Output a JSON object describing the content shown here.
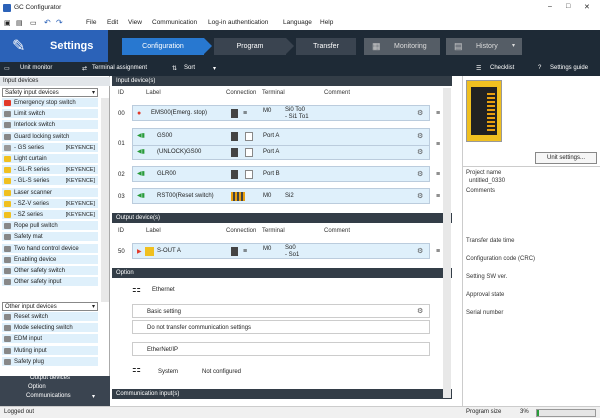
{
  "window": {
    "title": "GC Configurator",
    "min": "–",
    "max": "□",
    "close": "✕"
  },
  "menu": [
    "File",
    "Edit",
    "View",
    "Communication",
    "Log-in authentication",
    "Language",
    "Help"
  ],
  "header": {
    "section": "Settings",
    "steps": [
      "Configuration",
      "Program",
      "Transfer"
    ],
    "monitor": "Monitoring",
    "history": "History"
  },
  "toolbar": {
    "unit_monitor": "Unit monitor",
    "terminal_assignment": "Terminal assignment",
    "sort": "Sort",
    "checklist": "Checklist",
    "settings_guide": "Settings guide"
  },
  "left": {
    "header": "Input devices",
    "category": "Safety input devices",
    "items": [
      {
        "label": "Emergency stop switch",
        "key": "",
        "color": "#e23a2a"
      },
      {
        "label": "Limit switch",
        "key": "",
        "color": "#888"
      },
      {
        "label": "Interlock switch",
        "key": "",
        "color": "#888"
      },
      {
        "label": "Guard locking switch",
        "key": "",
        "color": "#888"
      },
      {
        "label": "- GS series",
        "key": "[KEYENCE]",
        "color": "#999"
      },
      {
        "label": "Light curtain",
        "key": "",
        "color": "#f0c020"
      },
      {
        "label": "- GL-R series",
        "key": "[KEYENCE]",
        "color": "#f0c020"
      },
      {
        "label": "- GL-S series",
        "key": "[KEYENCE]",
        "color": "#f0c020"
      },
      {
        "label": "Laser scanner",
        "key": "",
        "color": "#f0c020"
      },
      {
        "label": "- SZ-V series",
        "key": "[KEYENCE]",
        "color": "#f0c020"
      },
      {
        "label": "- SZ series",
        "key": "[KEYENCE]",
        "color": "#f0c020"
      },
      {
        "label": "Rope pull switch",
        "key": "",
        "color": "#888"
      },
      {
        "label": "Safety mat",
        "key": "",
        "color": "#888"
      },
      {
        "label": "Two hand control device",
        "key": "",
        "color": "#888"
      },
      {
        "label": "Enabling device",
        "key": "",
        "color": "#888"
      },
      {
        "label": "Other safety switch",
        "key": "",
        "color": "#888"
      },
      {
        "label": "Other safety input",
        "key": "",
        "color": "#888"
      }
    ],
    "category2": "Other input devices",
    "items2": [
      "Reset switch",
      "Mode selecting switch",
      "EDM input",
      "Muting input",
      "Safety plug"
    ],
    "footer": [
      "Output devices",
      "Option",
      "Communications"
    ]
  },
  "main": {
    "input_header": "Input device(s)",
    "cols": {
      "id": "ID",
      "label": "Label",
      "connection": "Connection",
      "terminal": "Terminal",
      "comment": "Comment"
    },
    "inputs": [
      {
        "id": "00",
        "label": "EMS00(Emerg. stop)",
        "t1": "M0",
        "t2": "Si0 To0",
        "t3": "- Si1 To1"
      },
      {
        "id": "01",
        "label": "GS00",
        "t1": "",
        "t2": "Port A",
        "t3": ""
      },
      {
        "id": "",
        "label": "(UNLOCK)GS00",
        "t1": "",
        "t2": "Port A",
        "t3": ""
      },
      {
        "id": "02",
        "label": "GLR00",
        "t1": "",
        "t2": "Port B",
        "t3": ""
      },
      {
        "id": "03",
        "label": "RST00(Reset switch)",
        "t1": "M0",
        "t2": "Si2",
        "t3": ""
      }
    ],
    "output_header": "Output device(s)",
    "outputs": [
      {
        "id": "50",
        "label": "S-OUT A",
        "t1": "M0",
        "t2": "So0",
        "t3": "- So1"
      }
    ],
    "option_header": "Option",
    "ethernet": "Ethernet",
    "basic_setting": "Basic setting",
    "no_transfer": "Do not transfer communication settings",
    "ethernetip": "EtherNet/IP",
    "system": "System",
    "not_configured": "Not configured",
    "comm_header": "Communication input(s)"
  },
  "right": {
    "unit_settings": "Unit settings...",
    "project_name_lbl": "Project name",
    "project_name": "untitled_0330",
    "comments": "Comments",
    "transfer_date": "Transfer date time",
    "config_code": "Configuration code (CRC)",
    "setting_sw": "Setting SW ver.",
    "approval": "Approval state",
    "serial": "Serial number"
  },
  "status": {
    "logged": "Logged out",
    "program_size": "Program size",
    "percent": "3%",
    "fill": 0.03
  }
}
